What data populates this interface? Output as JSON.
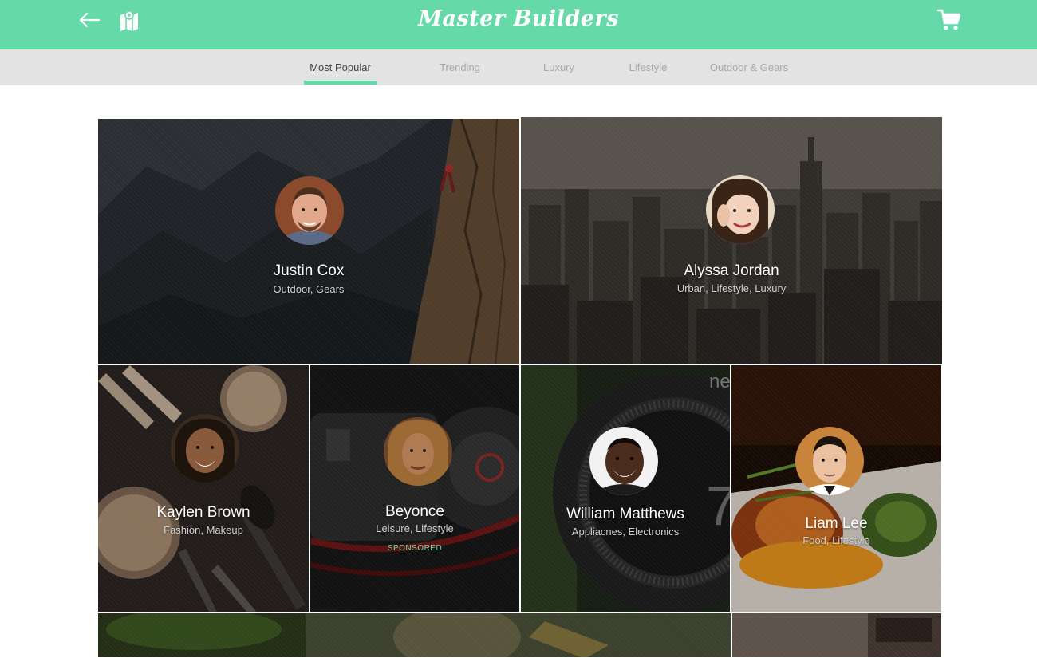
{
  "app": {
    "title": "Master Builders"
  },
  "header": {
    "back_icon": "arrow-left-icon",
    "map_icon": "map-icon",
    "cart_icon": "shopping-cart-icon",
    "color": "#66d9a8"
  },
  "tabs": [
    {
      "label": "Most Popular",
      "active": true
    },
    {
      "label": "Trending",
      "active": false
    },
    {
      "label": "Luxury",
      "active": false
    },
    {
      "label": "Lifestyle",
      "active": false
    },
    {
      "label": "Outdoor & Gears",
      "active": false
    }
  ],
  "builders": [
    {
      "name": "Justin Cox",
      "tags": "Outdoor, Gears",
      "background": "rock-climbing"
    },
    {
      "name": "Alyssa Jordan",
      "tags": "Urban, Lifestyle, Luxury",
      "background": "city-skyline"
    },
    {
      "name": "Kaylen Brown",
      "tags": "Fashion, Makeup",
      "background": "makeup-brushes"
    },
    {
      "name": "Beyonce",
      "tags": "Leisure, Lifestyle",
      "badge": "SPONSORED",
      "background": "headphones"
    },
    {
      "name": "William Matthews",
      "tags": "Appliacnes, Electronics",
      "background": "thermostat"
    },
    {
      "name": "Liam Lee",
      "tags": "Food, Lifestyle",
      "background": "food-plate"
    }
  ],
  "colors": {
    "accent": "#66d9a8",
    "tabbar": "#e3e3e3"
  }
}
